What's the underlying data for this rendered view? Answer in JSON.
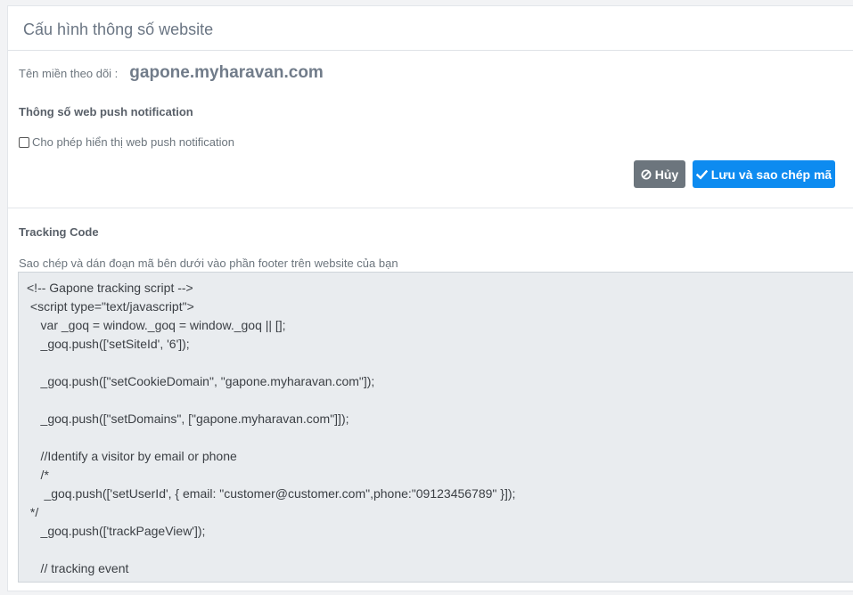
{
  "panel": {
    "title": "Cấu hình thông số website"
  },
  "domain": {
    "label": "Tên miền theo dõi :",
    "value": "gapone.myharavan.com"
  },
  "webpush": {
    "section_title": "Thông số web push notification",
    "checkbox_label": "Cho phép hiển thị web push notification",
    "checkbox_checked": false
  },
  "actions": {
    "cancel_label": "Hủy",
    "cancel_icon": "ban-icon",
    "save_label": "Lưu và sao chép mã",
    "save_icon": "check-icon"
  },
  "tracking": {
    "section_title": "Tracking Code",
    "helper_text": "Sao chép và dán đoạn mã bên dưới vào phần footer trên website của bạn",
    "code_lines": [
      "<!-- Gapone tracking script -->",
      " <script type=\"text/javascript\">",
      "    var _goq = window._goq = window._goq || [];",
      "    _goq.push(['setSiteId', '6']);",
      "",
      "    _goq.push([\"setCookieDomain\", \"gapone.myharavan.com\"]);",
      "",
      "    _goq.push([\"setDomains\", [\"gapone.myharavan.com\"]]);",
      "",
      "    //Identify a visitor by email or phone",
      "    /*",
      "     _goq.push(['setUserId', { email: \"customer@customer.com\",phone:\"09123456789\" }]);",
      " */",
      "    _goq.push(['trackPageView']);",
      "",
      "    // tracking event",
      "    /*"
    ]
  },
  "colors": {
    "primary": "#0d8bf0",
    "secondary": "#6c757d",
    "code_bg": "#e9ecef"
  }
}
